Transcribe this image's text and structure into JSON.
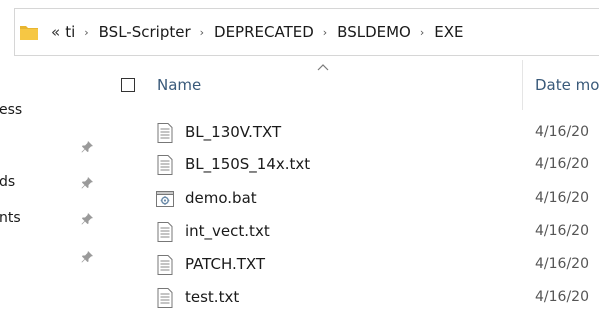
{
  "address_bar": {
    "overflow": "«",
    "crumbs": [
      "ti",
      "BSL-Scripter",
      "DEPRECATED",
      "BSLDEMO",
      "EXE"
    ],
    "separator": "›"
  },
  "nav_pane": {
    "items": [
      {
        "label": "ess",
        "pinned": false
      },
      {
        "label": "",
        "pinned": true
      },
      {
        "label": "ds",
        "pinned": true
      },
      {
        "label": "nts",
        "pinned": true
      },
      {
        "label": "",
        "pinned": true
      }
    ]
  },
  "columns": {
    "name": "Name",
    "date": "Date mo"
  },
  "files": [
    {
      "name": "BL_130V.TXT",
      "date": "4/16/20",
      "icon": "text-file-icon"
    },
    {
      "name": "BL_150S_14x.txt",
      "date": "4/16/20",
      "icon": "text-file-icon"
    },
    {
      "name": "demo.bat",
      "date": "4/16/20",
      "icon": "batch-file-icon"
    },
    {
      "name": "int_vect.txt",
      "date": "4/16/20",
      "icon": "text-file-icon"
    },
    {
      "name": "PATCH.TXT",
      "date": "4/16/20",
      "icon": "text-file-icon"
    },
    {
      "name": "test.txt",
      "date": "4/16/20",
      "icon": "text-file-icon"
    }
  ],
  "colors": {
    "folder": "#f6c744",
    "header_text": "#3a5a7a"
  }
}
